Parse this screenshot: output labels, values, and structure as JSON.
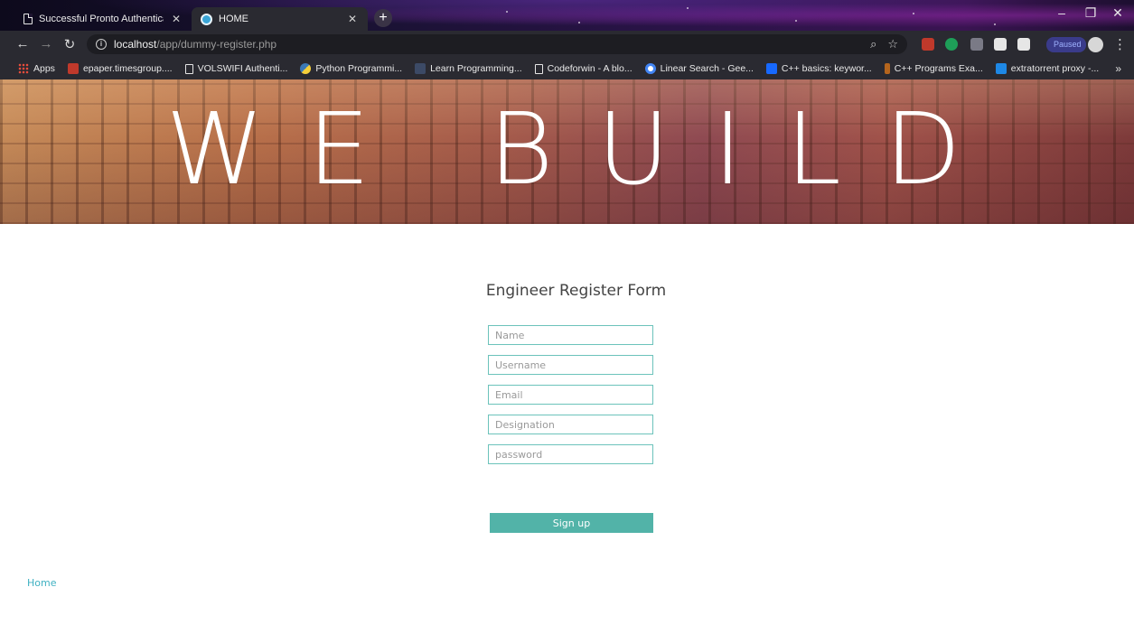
{
  "browser": {
    "tabs": [
      {
        "title": "Successful Pronto Authentication",
        "active": false
      },
      {
        "title": "HOME",
        "active": true
      }
    ],
    "url_host": "localhost",
    "url_path": "/app/dummy-register.php",
    "paused_label": "Paused",
    "bookmarks": [
      {
        "label": "Apps"
      },
      {
        "label": "epaper.timesgroup...."
      },
      {
        "label": "VOLSWIFI Authenti..."
      },
      {
        "label": "Python Programmi..."
      },
      {
        "label": "Learn Programming..."
      },
      {
        "label": "Codeforwin - A blo..."
      },
      {
        "label": "Linear Search - Gee..."
      },
      {
        "label": "C++ basics: keywor..."
      },
      {
        "label": "C++ Programs Exa..."
      },
      {
        "label": "extratorrent proxy -..."
      }
    ]
  },
  "hero": {
    "title": "WE BUILD"
  },
  "form": {
    "title": "Engineer Register Form",
    "fields": [
      {
        "placeholder": "Name"
      },
      {
        "placeholder": "Username"
      },
      {
        "placeholder": "Email"
      },
      {
        "placeholder": "Designation"
      },
      {
        "placeholder": "password"
      }
    ],
    "submit_label": "Sign up"
  },
  "footer": {
    "home_link": "Home"
  },
  "colors": {
    "accent": "#52b3a8",
    "field_border": "#6cc3bb",
    "link": "#3fb1c2"
  }
}
